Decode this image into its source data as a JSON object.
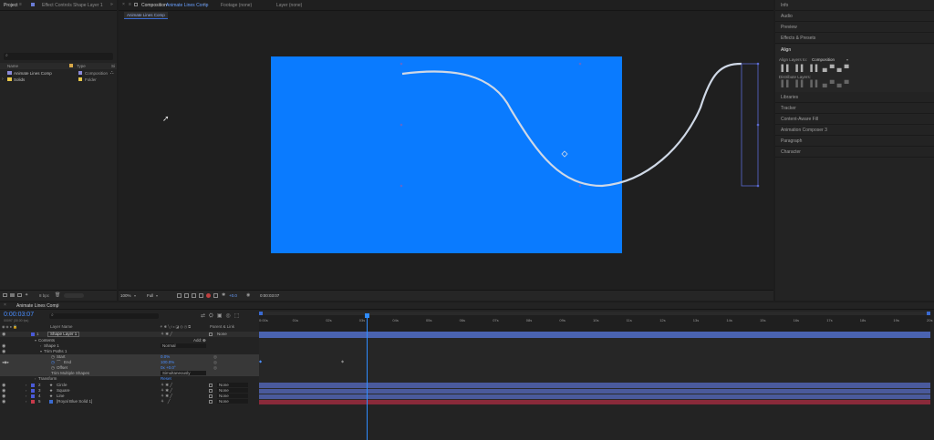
{
  "project_panel": {
    "tabs": [
      "Project",
      "Effect Controls Shape Layer 1"
    ],
    "search_placeholder": "",
    "col_name": "Name",
    "col_type": "Type",
    "col_size": "Si",
    "items": [
      {
        "name": "Animate Lines Comp",
        "type": "Composition",
        "color": "#8a8ad8"
      },
      {
        "name": "Solids",
        "type": "Folder",
        "color": "#e8c84a"
      }
    ],
    "bpc": "8 bpc"
  },
  "viewer": {
    "tabs": [
      "Composition",
      "Animate Lines Comp",
      "Footage (none)",
      "Layer (none)"
    ],
    "sub_tab": "Animate Lines Comp",
    "bg_color": "#0a7bff",
    "zoom": "100%",
    "resolution": "Full",
    "exposure": "+0.0",
    "timecode": "0:00:03:07"
  },
  "right_panel": {
    "tabs_top": [
      "Info",
      "Audio",
      "Preview",
      "Effects & Presets"
    ],
    "align": {
      "title": "Align",
      "align_to_label": "Align Layers to:",
      "align_to_value": "Composition",
      "distribute_label": "Distribute Layers:"
    },
    "tabs_bottom": [
      "Libraries",
      "Tracker",
      "Content-Aware Fill",
      "Animation Composer 3",
      "Paragraph",
      "Character"
    ]
  },
  "timeline": {
    "comp_tab": "Animate Lines Comp",
    "timecode": "0:00:03:07",
    "timecode_sub": "00097 (30.00 fps)",
    "header_layer_name": "Layer Name",
    "header_parent": "Parent & Link",
    "ruler": [
      "0:00s",
      "01s",
      "02s",
      "03s",
      "04s",
      "05s",
      "06s",
      "07s",
      "08s",
      "09s",
      "10s",
      "11s",
      "12s",
      "13s",
      "14s",
      "15s",
      "16s",
      "17s",
      "18s",
      "19s",
      "20s"
    ],
    "playhead_fraction": 0.161,
    "rows": [
      {
        "num": "1",
        "name": "Shape Layer 1",
        "parent": "None",
        "kind": "layer"
      },
      {
        "label": "Contents",
        "value": "",
        "kind": "group"
      },
      {
        "label": "Shape 1",
        "value": "Normal",
        "kind": "group"
      },
      {
        "label": "Trim Paths 1",
        "value": "",
        "kind": "group"
      },
      {
        "label": "Start",
        "value": "0.0%",
        "kind": "prop"
      },
      {
        "label": "End",
        "value": "100.0%",
        "kind": "prop"
      },
      {
        "label": "Offset",
        "value": "0x +0.0°",
        "kind": "prop"
      },
      {
        "label": "Trim Multiple Shapes",
        "value": "Simultaneously",
        "kind": "prop"
      },
      {
        "label": "Transform",
        "value": "Reset",
        "kind": "group"
      },
      {
        "num": "2",
        "name": "Circle",
        "parent": "None",
        "kind": "layer"
      },
      {
        "num": "3",
        "name": "Square",
        "parent": "None",
        "kind": "layer"
      },
      {
        "num": "4",
        "name": "Line",
        "parent": "None",
        "kind": "layer"
      },
      {
        "num": "5",
        "name": "[Royal Blue Solid 1]",
        "parent": "None",
        "kind": "layer"
      }
    ],
    "add_label": "Add:",
    "colors": {
      "layer_blue": "#4a5a9c",
      "layer_red": "#8a2a3a",
      "playhead": "#2f8cff"
    }
  }
}
